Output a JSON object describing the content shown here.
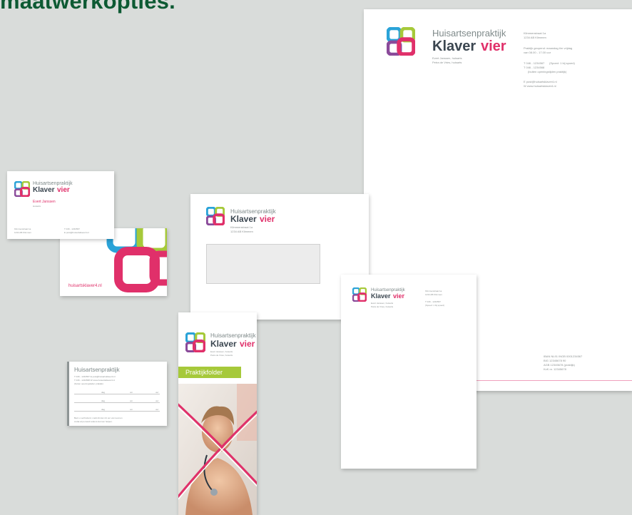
{
  "heading": "maatwerkopties.",
  "logo": {
    "line1": "Huisartsenpraktijk",
    "word_klaver": "Klaver",
    "word_vier": "vier"
  },
  "letterhead": {
    "doctors": [
      "Evert Janssen, huisarts",
      "Petra de Vries, huisarts"
    ],
    "address": [
      "Klimmenstraat 1a",
      "1234 AB Klimmen"
    ],
    "hours": [
      "Praktijk geopend: maandag t/m vrijdag",
      "van 08.00 - 17.00 uur"
    ],
    "phone1": "T  046 - 1234567",
    "phone1_extra": "(Spoed: 1 bij spoed)",
    "phone2": "T  046 - 1234568",
    "phone2_note": "(buiten openingstijden praktijk)",
    "email": "E  post@huisartsklaver4.nl",
    "web": "W  www.huisartsklaver4.nl",
    "bank": [
      "IBAN NL91 INGB 0001234567",
      "BIG 12345678 90",
      "AGB 12345678 (praktijk)",
      "KvK nr. 12345678"
    ]
  },
  "business_card": {
    "name": "Evert Janssen",
    "role": "Huisarts",
    "address": [
      "Klimmenstraat 1a",
      "1234 AB Klimmen"
    ],
    "phone": "T  046 - 1234567",
    "email": "E  post@huisartsklaver4.nl",
    "url": "huisartsklaver4.nl"
  },
  "envelope": {
    "address": [
      "Klimmenstraat 1a",
      "1234 AB Klimmen"
    ]
  },
  "compliment_card": {
    "doctors": [
      "Evert Janssen, huisarts",
      "Petra de Vries, huisarts"
    ],
    "address": [
      "Klimmenstraat 1a",
      "1234 AB Klimmen"
    ],
    "phone": "T  046 - 1234567",
    "phone_note": "(Spoed: 1 bij spoed)"
  },
  "appointment_card": {
    "title": "Huisartsenpraktijk",
    "info": [
      "T  046 - 1234567   E  post@huisartsklaver4.nl",
      "T  046 - 1234568   W  www.huisartsklaver4.nl",
      "(buiten openingstijden praktijk)"
    ],
    "rows": [
      {
        "day": "dag",
        "time": "om",
        "unit": "uur"
      },
      {
        "day": "dag",
        "time": "om",
        "unit": "uur"
      },
      {
        "day": "dag",
        "time": "om",
        "unit": "uur"
      }
    ],
    "footer": [
      "Bent u verhinderd, meld dit dan 24 uur van tevoren",
      "zodat wij iemand anders kunnen helpen."
    ]
  },
  "folder": {
    "doctors": [
      "Evert Janssen, huisarts",
      "Petra de Vries, huisarts"
    ],
    "label": "Praktijkfolder"
  },
  "colors": {
    "green_heading": "#0d5a33",
    "pink": "#e0306a",
    "blue": "#2aa3d8",
    "lime": "#a6c93a",
    "background": "#d9dcda"
  }
}
